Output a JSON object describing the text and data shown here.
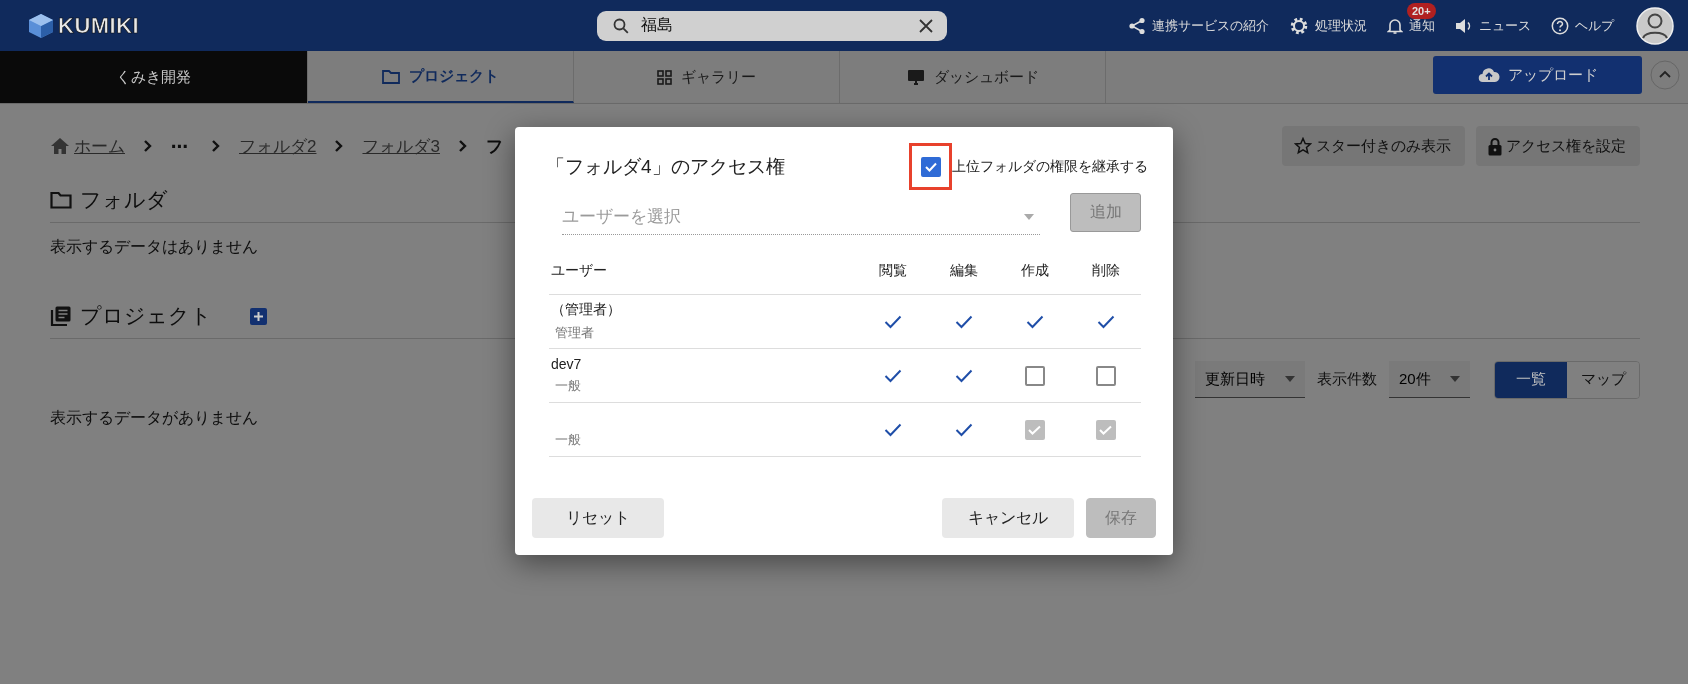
{
  "header": {
    "logo": "KUMIKI",
    "search": {
      "value": "福島"
    },
    "nav": [
      {
        "label": "連携サービスの紹介",
        "kind": "share"
      },
      {
        "label": "処理状況",
        "kind": "gear"
      },
      {
        "label": "通知",
        "kind": "bell",
        "badge": "20+"
      },
      {
        "label": "ニュース",
        "kind": "speaker"
      },
      {
        "label": "ヘルプ",
        "kind": "help"
      }
    ]
  },
  "tabs": [
    {
      "label": "くみき開発",
      "kind": "org",
      "selected": false
    },
    {
      "label": "プロジェクト",
      "kind": "folder",
      "selected": true
    },
    {
      "label": "ギャラリー",
      "kind": "grid",
      "selected": false
    },
    {
      "label": "ダッシュボード",
      "kind": "monitor",
      "selected": false
    }
  ],
  "upload_button": "アップロード",
  "breadcrumb": [
    {
      "label": "ホーム",
      "kind": "home"
    },
    {
      "label": "⋯",
      "kind": "more"
    },
    {
      "label": "フォルダ2",
      "kind": "link"
    },
    {
      "label": "フォルダ3",
      "kind": "link"
    },
    {
      "label": "フ",
      "kind": "current"
    }
  ],
  "toolbar": [
    {
      "label": "スター付きのみ表示",
      "kind": "star"
    },
    {
      "label": "アクセス権を設定",
      "kind": "lock"
    }
  ],
  "sections": [
    {
      "title": "フォルダ",
      "kind": "folder",
      "empty": "表示するデータはありません"
    },
    {
      "title": "プロジェクト",
      "kind": "project",
      "empty": "表示するデータがありません"
    }
  ],
  "sort": {
    "value": "更新日時"
  },
  "page_size": {
    "label": "表示件数",
    "value": "20件"
  },
  "view_toggle": [
    {
      "label": "一覧",
      "selected": true
    },
    {
      "label": "マップ",
      "selected": false
    }
  ],
  "dialog": {
    "title": "「フォルダ4」のアクセス権",
    "inherit": {
      "label": "上位フォルダの権限を継承する",
      "checked": true,
      "highlighted": true
    },
    "user_select": {
      "placeholder": "ユーザーを選択"
    },
    "add_button": {
      "label": "追加",
      "disabled": true
    },
    "columns": [
      "ユーザー",
      "閲覧",
      "編集",
      "作成",
      "削除"
    ],
    "rows": [
      {
        "name": "（管理者）",
        "role": "管理者",
        "permissions": [
          {
            "kind": "tick"
          },
          {
            "kind": "tick"
          },
          {
            "kind": "tick"
          },
          {
            "kind": "tick"
          }
        ]
      },
      {
        "name": "dev7",
        "role": "一般",
        "permissions": [
          {
            "kind": "tick"
          },
          {
            "kind": "tick"
          },
          {
            "kind": "checkbox",
            "checked": false,
            "disabled": false
          },
          {
            "kind": "checkbox",
            "checked": false,
            "disabled": false
          }
        ]
      },
      {
        "role": "一般",
        "permissions": [
          {
            "kind": "tick"
          },
          {
            "kind": "tick"
          },
          {
            "kind": "checkbox",
            "checked": true,
            "disabled": true
          },
          {
            "kind": "checkbox",
            "checked": true,
            "disabled": true
          }
        ]
      }
    ],
    "reset_button": "リセット",
    "cancel_button": "キャンセル",
    "save_button": {
      "label": "保存",
      "disabled": true
    }
  }
}
